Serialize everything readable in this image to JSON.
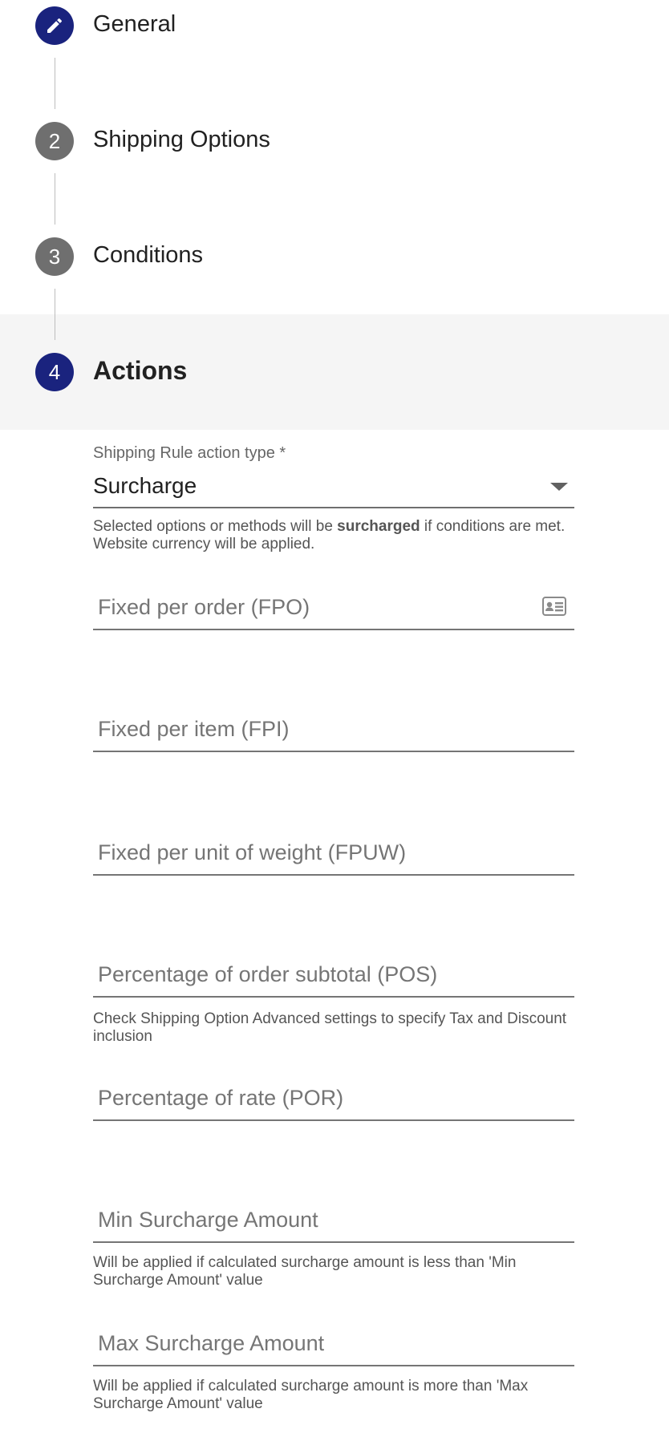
{
  "stepper": {
    "steps": [
      {
        "number": "",
        "label": "General",
        "state": "done",
        "icon": "pencil-icon"
      },
      {
        "number": "2",
        "label": "Shipping Options",
        "state": "todo"
      },
      {
        "number": "3",
        "label": "Conditions",
        "state": "todo"
      },
      {
        "number": "4",
        "label": "Actions",
        "state": "active"
      }
    ]
  },
  "form": {
    "action_type": {
      "label": "Shipping Rule action type *",
      "value": "Surcharge",
      "hint_before": "Selected options or methods will be ",
      "hint_bold": "surcharged",
      "hint_after": " if conditions are met. Website currency will be applied."
    },
    "fpo": {
      "placeholder": "Fixed per order (FPO)",
      "icon": "contact-card-icon"
    },
    "fpi": {
      "placeholder": "Fixed per item (FPI)"
    },
    "fpuw": {
      "placeholder": "Fixed per unit of weight (FPUW)"
    },
    "pos": {
      "placeholder": "Percentage of order subtotal (POS)",
      "hint": "Check Shipping Option Advanced settings to specify Tax and Discount inclusion"
    },
    "por": {
      "placeholder": "Percentage of rate (POR)"
    },
    "min": {
      "placeholder": "Min Surcharge Amount",
      "hint": "Will be applied if calculated surcharge amount is less than 'Min Surcharge Amount' value"
    },
    "max": {
      "placeholder": "Max Surcharge Amount",
      "hint": "Will be applied if calculated surcharge amount is more than 'Max Surcharge Amount' value"
    }
  },
  "colors": {
    "primary": "#1a237e",
    "inactive_step": "#6f6f6f",
    "active_step_bg": "#f5f5f5"
  }
}
